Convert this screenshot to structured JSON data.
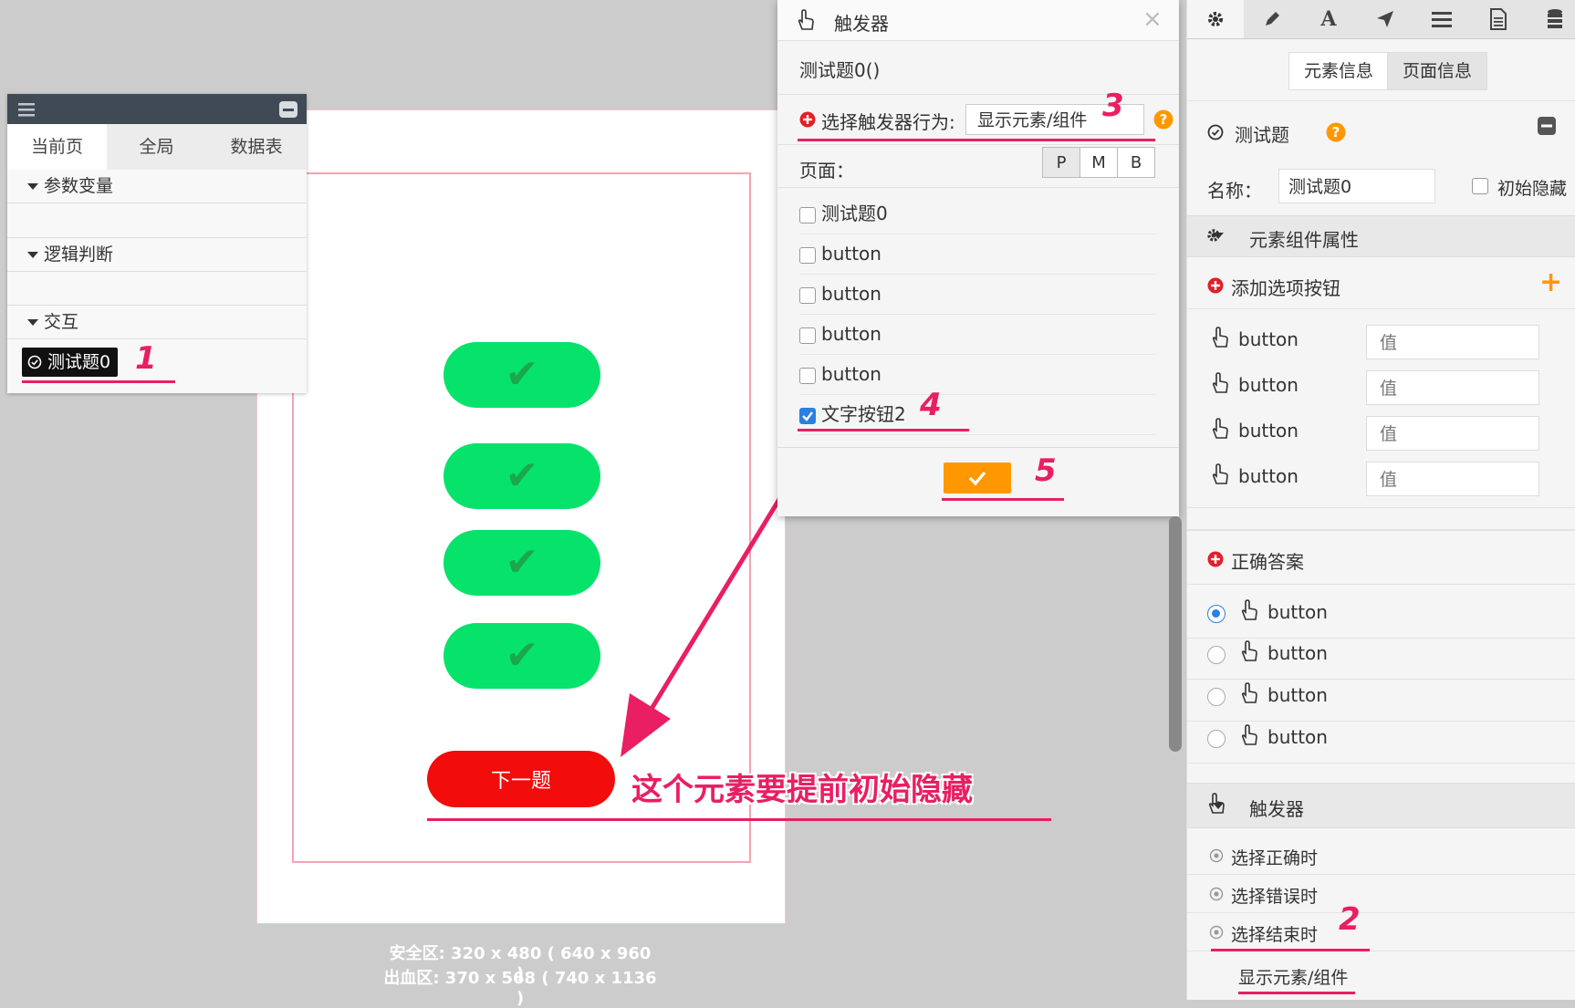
{
  "canvas": {
    "options": [
      "✔",
      "✔",
      "✔",
      "✔"
    ],
    "next_label": "下一题",
    "safe_area": "安全区: 320 x 480 ( 640 x 960 )",
    "bleed_area": "出血区: 370 x 568 ( 740 x 1136 )",
    "annotation": "这个元素要提前初始隐藏"
  },
  "left_panel": {
    "tabs": [
      "当前页",
      "全局",
      "数据表"
    ],
    "sections": [
      "参数变量",
      "逻辑判断",
      "交互"
    ],
    "item": "测试题0"
  },
  "dialog": {
    "title": "触发器",
    "subtitle": "测试题0()",
    "behavior_label": "选择触发器行为:",
    "behavior_value": "显示元素/组件",
    "page_label": "页面：",
    "page_modes": [
      "P",
      "M",
      "B"
    ],
    "objects": [
      {
        "label": "测试题0",
        "checked": false
      },
      {
        "label": "button",
        "checked": false
      },
      {
        "label": "button",
        "checked": false
      },
      {
        "label": "button",
        "checked": false
      },
      {
        "label": "button",
        "checked": false
      },
      {
        "label": "文字按钮2",
        "checked": true
      }
    ]
  },
  "right_panel": {
    "tabs": [
      "元素信息",
      "页面信息"
    ],
    "component_title": "测试题",
    "name_label": "名称：",
    "name_value": "测试题0",
    "initial_hidden_label": "初始隐藏",
    "properties_header": "元素组件属性",
    "add_option_label": "添加选项按钮",
    "option_buttons": [
      {
        "label": "button",
        "placeholder": "值"
      },
      {
        "label": "button",
        "placeholder": "值"
      },
      {
        "label": "button",
        "placeholder": "值"
      },
      {
        "label": "button",
        "placeholder": "值"
      }
    ],
    "correct_answer_label": "正确答案",
    "answers": [
      {
        "label": "button",
        "selected": true
      },
      {
        "label": "button",
        "selected": false
      },
      {
        "label": "button",
        "selected": false
      },
      {
        "label": "button",
        "selected": false
      }
    ],
    "trigger_header": "触发器",
    "triggers": [
      "选择正确时",
      "选择错误时",
      "选择结束时"
    ],
    "trigger_action": "显示元素/组件"
  },
  "callouts": [
    "1",
    "2",
    "3",
    "4",
    "5"
  ],
  "colors": {
    "accent": "#e91e63",
    "green": "#07e26b",
    "red": "#f20c0c",
    "orange": "#ff9800",
    "blue": "#2b7fe0"
  }
}
